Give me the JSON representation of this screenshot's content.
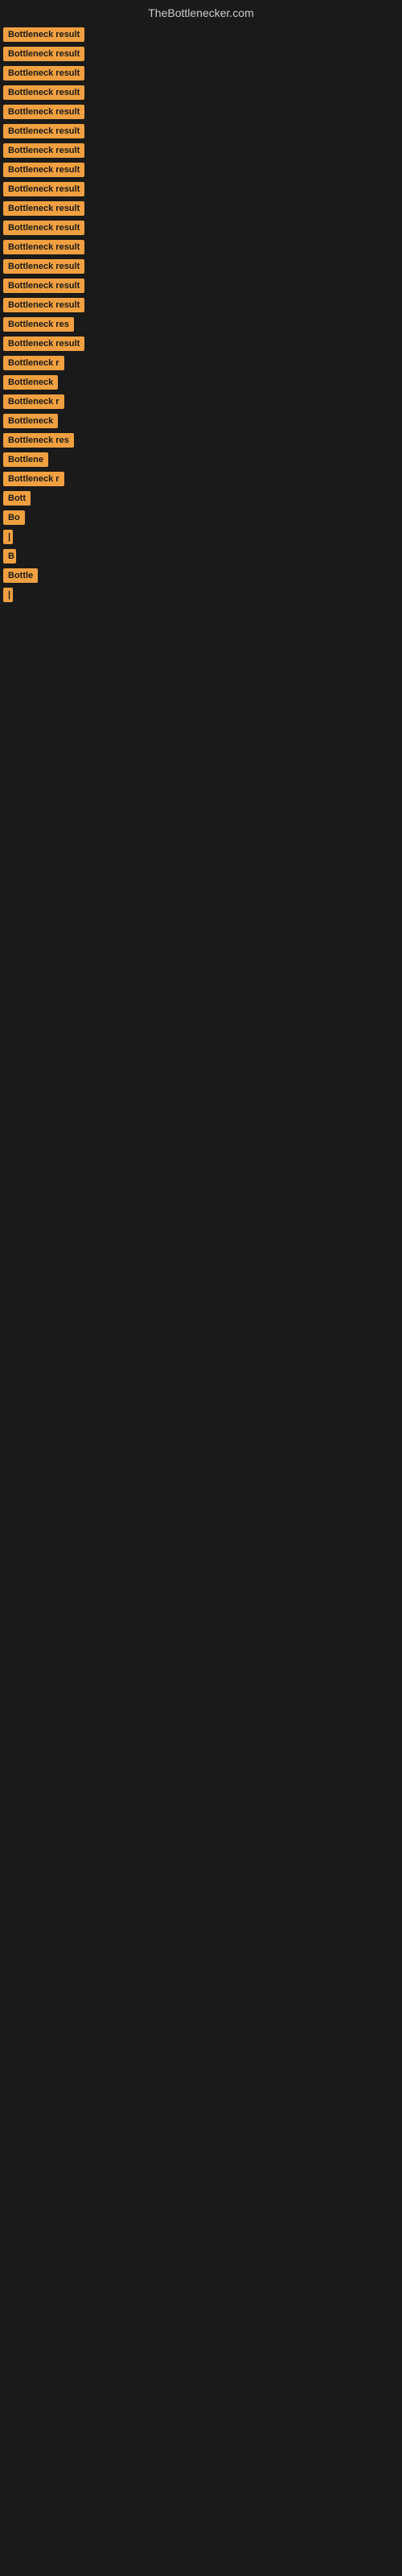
{
  "site": {
    "title": "TheBottlenecker.com"
  },
  "items": [
    {
      "label": "Bottleneck result",
      "width": 130
    },
    {
      "label": "Bottleneck result",
      "width": 130
    },
    {
      "label": "Bottleneck result",
      "width": 130
    },
    {
      "label": "Bottleneck result",
      "width": 130
    },
    {
      "label": "Bottleneck result",
      "width": 130
    },
    {
      "label": "Bottleneck result",
      "width": 130
    },
    {
      "label": "Bottleneck result",
      "width": 130
    },
    {
      "label": "Bottleneck result",
      "width": 130
    },
    {
      "label": "Bottleneck result",
      "width": 130
    },
    {
      "label": "Bottleneck result",
      "width": 130
    },
    {
      "label": "Bottleneck result",
      "width": 130
    },
    {
      "label": "Bottleneck result",
      "width": 115
    },
    {
      "label": "Bottleneck result",
      "width": 115
    },
    {
      "label": "Bottleneck result",
      "width": 110
    },
    {
      "label": "Bottleneck result",
      "width": 110
    },
    {
      "label": "Bottleneck res",
      "width": 100
    },
    {
      "label": "Bottleneck result",
      "width": 110
    },
    {
      "label": "Bottleneck r",
      "width": 88
    },
    {
      "label": "Bottleneck",
      "width": 75
    },
    {
      "label": "Bottleneck r",
      "width": 88
    },
    {
      "label": "Bottleneck",
      "width": 72
    },
    {
      "label": "Bottleneck res",
      "width": 100
    },
    {
      "label": "Bottlene",
      "width": 68
    },
    {
      "label": "Bottleneck r",
      "width": 85
    },
    {
      "label": "Bott",
      "width": 42
    },
    {
      "label": "Bo",
      "width": 28
    },
    {
      "label": "|",
      "width": 10
    },
    {
      "label": "B",
      "width": 16
    },
    {
      "label": "Bottle",
      "width": 48
    },
    {
      "label": "|",
      "width": 8
    }
  ]
}
